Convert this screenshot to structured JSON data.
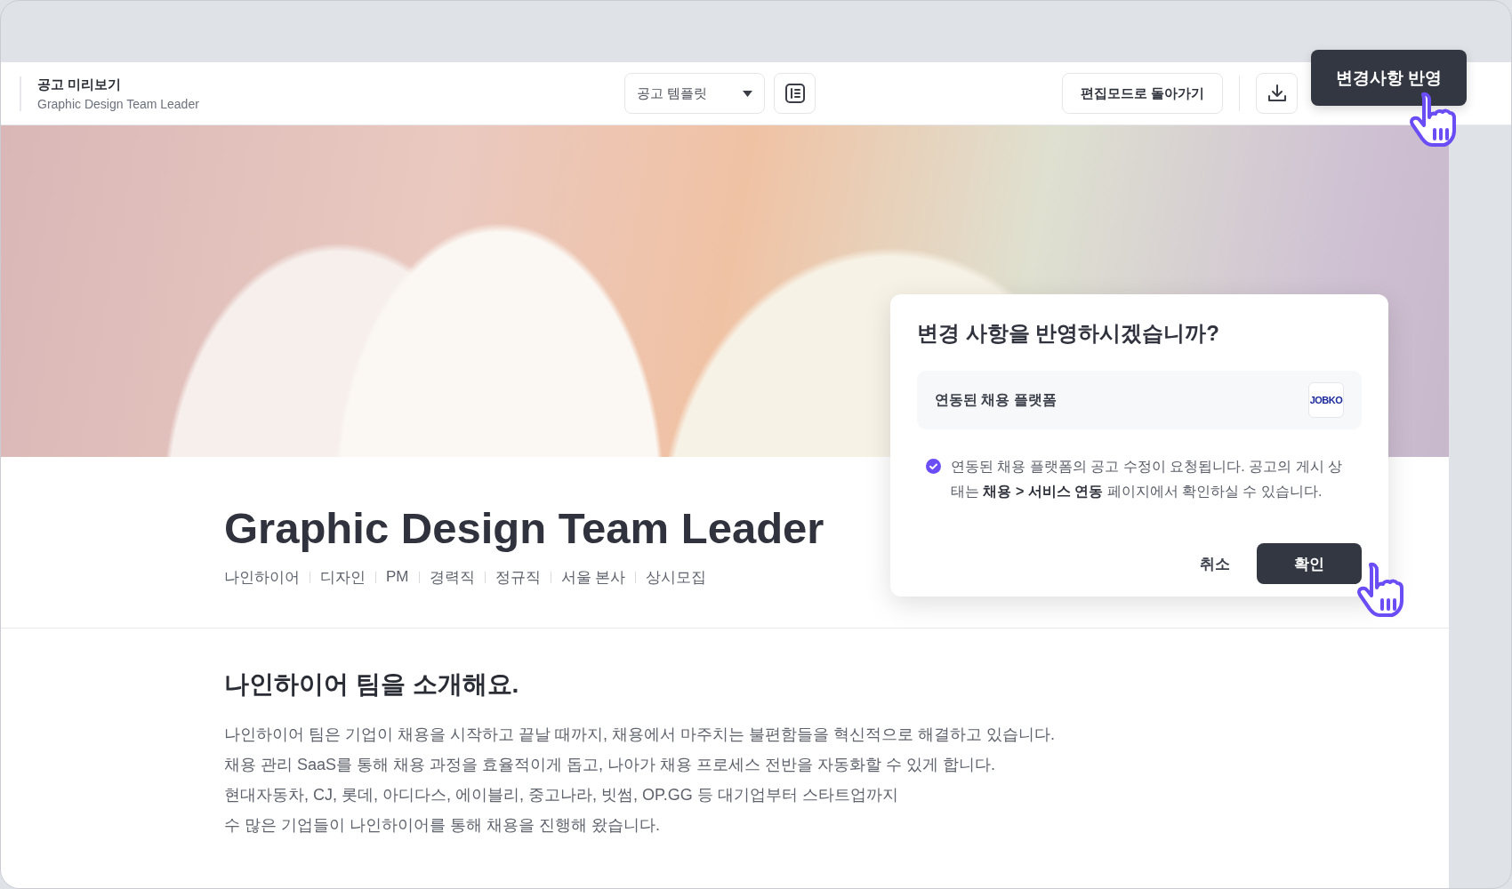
{
  "header": {
    "title": "공고 미리보기",
    "subtitle": "Graphic Design Team Leader",
    "template_select": {
      "value": "공고 템플릿"
    },
    "back_button": "편집모드로 돌아가기",
    "apply_button": "변경사항 반영"
  },
  "job": {
    "title": "Graphic Design Team Leader",
    "tags": [
      "나인하이어",
      "디자인",
      "PM",
      "경력직",
      "정규직",
      "서울 본사",
      "상시모집"
    ]
  },
  "intro": {
    "heading": "나인하이어 팀을 소개해요.",
    "paragraphs": [
      "나인하이어 팀은 기업이 채용을 시작하고 끝날 때까지, 채용에서 마주치는 불편함들을 혁신적으로 해결하고 있습니다.",
      "채용 관리 SaaS를 통해 채용 과정을 효율적이게 돕고, 나아가 채용 프로세스 전반을 자동화할 수 있게 합니다.",
      "현대자동차, CJ, 롯데, 아디다스, 에이블리, 중고나라, 빗썸, OP.GG 등 대기업부터 스타트업까지",
      "수 많은 기업들이 나인하이어를 통해 채용을 진행해 왔습니다."
    ]
  },
  "dialog": {
    "title": "변경 사항을 반영하시겠습니까?",
    "platform_label": "연동된 채용 플랫폼",
    "platform_logo": "JOBKO",
    "notice": "연동된 채용 플랫폼의 공고 수정이 요청됩니다. 공고의 게시 상태는 **채용 > 서비스 연동** 페이지에서 확인하실 수 있습니다.",
    "cancel_button": "취소",
    "confirm_button": "확인"
  }
}
